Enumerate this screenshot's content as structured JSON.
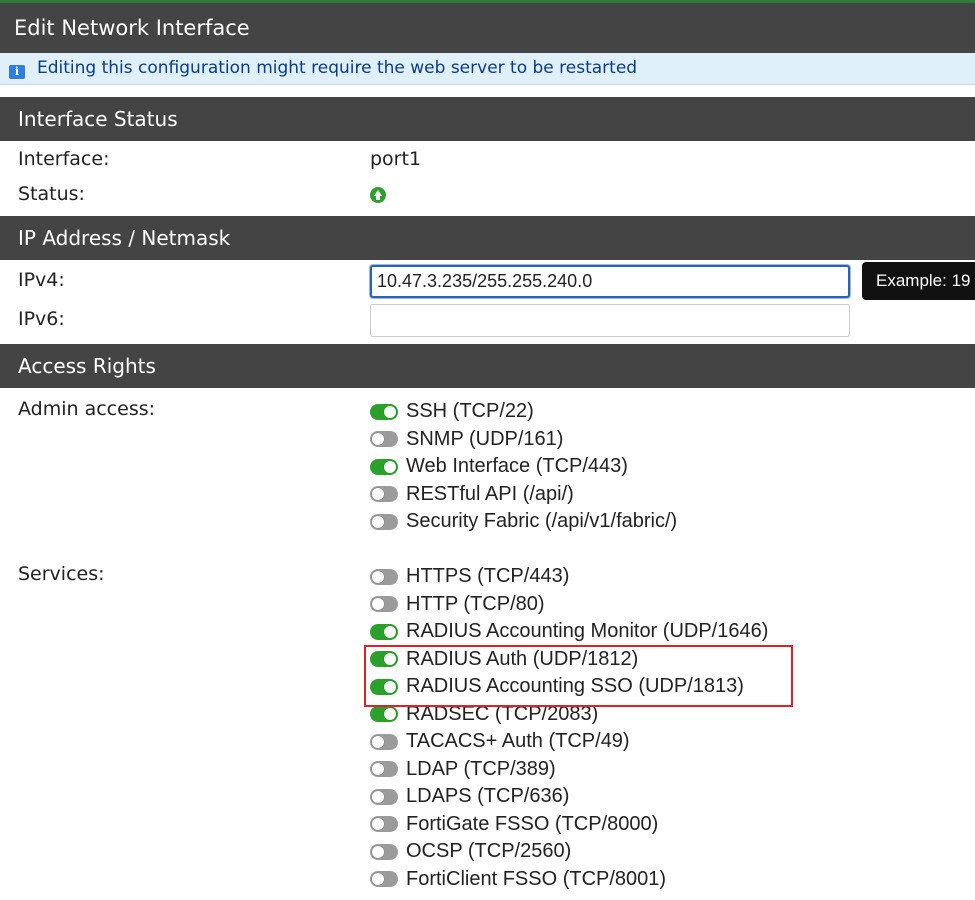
{
  "window": {
    "title": "Edit Network Interface",
    "notice": "Editing this configuration might require the web server to be restarted",
    "notice_icon": "info-icon"
  },
  "interface_status": {
    "header": "Interface Status",
    "interface_label": "Interface:",
    "interface_value": "port1",
    "status_label": "Status:",
    "status_icon": "status-up-icon",
    "status_color": "#2e9e2e"
  },
  "ip": {
    "header": "IP Address / Netmask",
    "ipv4_label": "IPv4:",
    "ipv4_value": "10.47.3.235/255.255.240.0",
    "ipv6_label": "IPv6:",
    "ipv6_value": "",
    "tooltip": "Example: 19"
  },
  "access": {
    "header": "Access Rights",
    "admin_label": "Admin access:",
    "admin_items": [
      {
        "label": "SSH (TCP/22)",
        "on": true
      },
      {
        "label": "SNMP (UDP/161)",
        "on": false
      },
      {
        "label": "Web Interface (TCP/443)",
        "on": true
      },
      {
        "label": "RESTful API (/api/)",
        "on": false
      },
      {
        "label": "Security Fabric (/api/v1/fabric/)",
        "on": false
      }
    ],
    "services_label": "Services:",
    "service_items": [
      {
        "label": "HTTPS (TCP/443)",
        "on": false
      },
      {
        "label": "HTTP (TCP/80)",
        "on": false
      },
      {
        "label": "RADIUS Accounting Monitor (UDP/1646)",
        "on": true
      },
      {
        "label": "RADIUS Auth (UDP/1812)",
        "on": true
      },
      {
        "label": "RADIUS Accounting SSO (UDP/1813)",
        "on": true
      },
      {
        "label": "RADSEC (TCP/2083)",
        "on": true
      },
      {
        "label": "TACACS+ Auth (TCP/49)",
        "on": false
      },
      {
        "label": "LDAP (TCP/389)",
        "on": false
      },
      {
        "label": "LDAPS (TCP/636)",
        "on": false
      },
      {
        "label": "FortiGate FSSO (TCP/8000)",
        "on": false
      },
      {
        "label": "OCSP (TCP/2560)",
        "on": false
      },
      {
        "label": "FortiClient FSSO (TCP/8001)",
        "on": false
      }
    ]
  },
  "colors": {
    "header_bg": "#444444",
    "toggle_on": "#2ba02b",
    "toggle_off": "#9b9b9b",
    "highlight": "#e0202a"
  }
}
